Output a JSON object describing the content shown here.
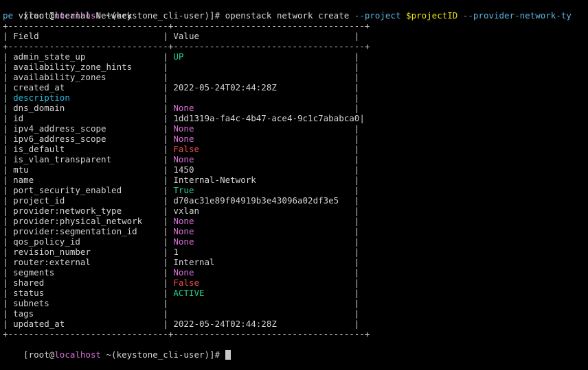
{
  "colors": {
    "default": "#d4d4d4",
    "host": "#d670d6",
    "option": "#5fb3e0",
    "variable": "#e5e510",
    "green": "#23d18b",
    "magenta": "#d670d6",
    "red": "#f14c4c",
    "cyan": "#29b8db",
    "background": "#000000"
  },
  "prompt": {
    "open": "[root@",
    "host": "localhost",
    "rest": " ~(keystone_cli-user)]# "
  },
  "command": {
    "line1": [
      {
        "t": "openstack network create ",
        "c": "cmd"
      },
      {
        "t": "--project ",
        "c": "opt"
      },
      {
        "t": "$projectID ",
        "c": "var"
      },
      {
        "t": "--provider-network-ty",
        "c": "opt"
      }
    ],
    "line2": [
      {
        "t": "pe",
        "c": "opt"
      },
      {
        "t": " vxlan Internal-Network",
        "c": "cmd"
      }
    ]
  },
  "table": {
    "border": "+-------------------------------+-------------------------------------+",
    "header": {
      "field": "Field",
      "value": "Value"
    },
    "field_width": 29,
    "value_width": 35,
    "rows": [
      {
        "field": "admin_state_up",
        "value": "UP",
        "fc": "default",
        "vc": "green"
      },
      {
        "field": "availability_zone_hints",
        "value": "",
        "fc": "default",
        "vc": "default"
      },
      {
        "field": "availability_zones",
        "value": "",
        "fc": "default",
        "vc": "default"
      },
      {
        "field": "created_at",
        "value": "2022-05-24T02:44:28Z",
        "fc": "default",
        "vc": "default"
      },
      {
        "field": "description",
        "value": "",
        "fc": "cyan",
        "vc": "default"
      },
      {
        "field": "dns_domain",
        "value": "None",
        "fc": "default",
        "vc": "magenta"
      },
      {
        "field": "id",
        "value": "1dd1319a-fa4c-4b47-ace4-9c1c7ababca0",
        "fc": "default",
        "vc": "default"
      },
      {
        "field": "ipv4_address_scope",
        "value": "None",
        "fc": "default",
        "vc": "magenta"
      },
      {
        "field": "ipv6_address_scope",
        "value": "None",
        "fc": "default",
        "vc": "magenta"
      },
      {
        "field": "is_default",
        "value": "False",
        "fc": "default",
        "vc": "red"
      },
      {
        "field": "is_vlan_transparent",
        "value": "None",
        "fc": "default",
        "vc": "magenta"
      },
      {
        "field": "mtu",
        "value": "1450",
        "fc": "default",
        "vc": "default"
      },
      {
        "field": "name",
        "value": "Internal-Network",
        "fc": "default",
        "vc": "default"
      },
      {
        "field": "port_security_enabled",
        "value": "True",
        "fc": "default",
        "vc": "green"
      },
      {
        "field": "project_id",
        "value": "d70ac31e89f04919b3e43096a02df3e5",
        "fc": "default",
        "vc": "default"
      },
      {
        "field": "provider:network_type",
        "value": "vxlan",
        "fc": "default",
        "vc": "default"
      },
      {
        "field": "provider:physical_network",
        "value": "None",
        "fc": "default",
        "vc": "magenta"
      },
      {
        "field": "provider:segmentation_id",
        "value": "None",
        "fc": "default",
        "vc": "magenta"
      },
      {
        "field": "qos_policy_id",
        "value": "None",
        "fc": "default",
        "vc": "magenta"
      },
      {
        "field": "revision_number",
        "value": "1",
        "fc": "default",
        "vc": "default"
      },
      {
        "field": "router:external",
        "value": "Internal",
        "fc": "default",
        "vc": "default"
      },
      {
        "field": "segments",
        "value": "None",
        "fc": "default",
        "vc": "magenta"
      },
      {
        "field": "shared",
        "value": "False",
        "fc": "default",
        "vc": "red"
      },
      {
        "field": "status",
        "value": "ACTIVE",
        "fc": "default",
        "vc": "green"
      },
      {
        "field": "subnets",
        "value": "",
        "fc": "default",
        "vc": "default"
      },
      {
        "field": "tags",
        "value": "",
        "fc": "default",
        "vc": "default"
      },
      {
        "field": "updated_at",
        "value": "2022-05-24T02:44:28Z",
        "fc": "default",
        "vc": "default"
      }
    ]
  }
}
